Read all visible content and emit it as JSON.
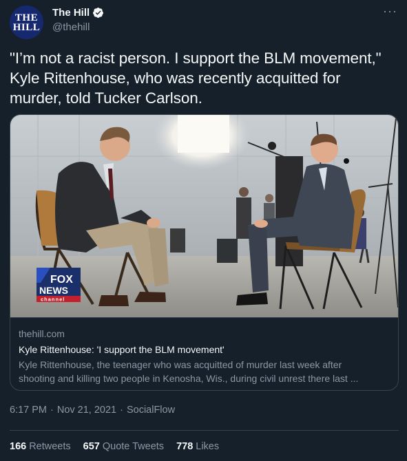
{
  "account": {
    "avatar_line1": "THE",
    "avatar_line2": "HILL",
    "name": "The Hill",
    "handle": "@thehill",
    "more": "···"
  },
  "tweet": {
    "text_line1": "\"I’m not a racist person. I support the BLM movement,\"",
    "text_line2": "Kyle Rittenhouse, who was recently acquitted for",
    "text_line3": "murder, told Tucker Carlson."
  },
  "card": {
    "logo_fox": "FOX",
    "logo_news": "NEWS",
    "logo_channel": "channel",
    "domain": "thehill.com",
    "title": "Kyle Rittenhouse: 'I support the BLM movement'",
    "description_line1": "Kyle Rittenhouse, the teenager who was acquitted of murder last week after",
    "description_line2": "shooting and killing two people in Kenosha, Wis., during civil unrest there last ..."
  },
  "meta": {
    "time": "6:17 PM",
    "sep1": "·",
    "date": "Nov 21, 2021",
    "sep2": "·",
    "source": "SocialFlow"
  },
  "stats": {
    "retweets_count": "166",
    "retweets_label": "Retweets",
    "quotes_count": "657",
    "quotes_label": "Quote Tweets",
    "likes_count": "778",
    "likes_label": "Likes"
  },
  "colors": {
    "background": "#15202b",
    "text_primary": "#f7f9f9",
    "text_secondary": "#8b98a5",
    "border": "#38444d",
    "verified": "#1d9bf0"
  }
}
